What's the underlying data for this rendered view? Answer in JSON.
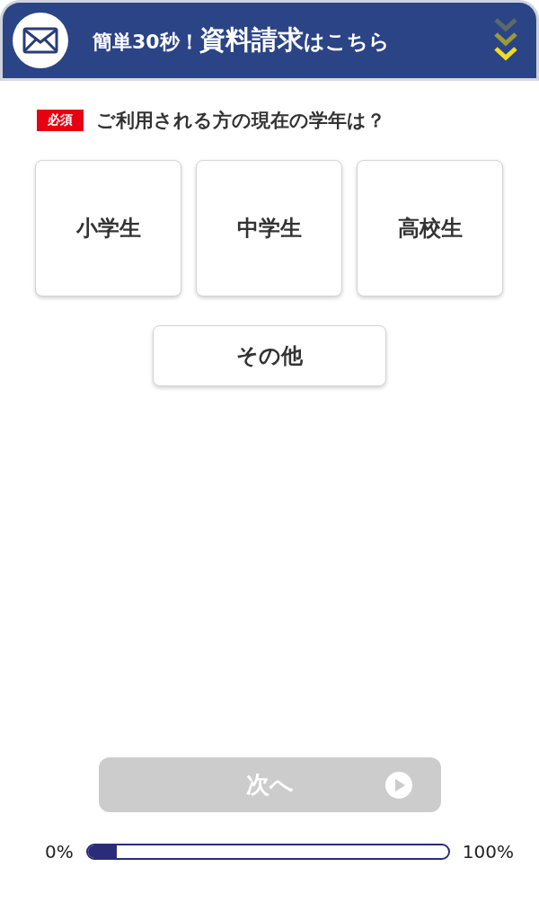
{
  "header": {
    "title_parts": [
      {
        "text": "簡単30秒！",
        "kind": "small"
      },
      {
        "text": "資料請求",
        "kind": "large"
      },
      {
        "text": "はこちら",
        "kind": "medium"
      }
    ]
  },
  "question": {
    "badge": "必須",
    "text": "ご利用される方の現在の学年は？"
  },
  "options": [
    {
      "label": "小学生",
      "selected": false,
      "kind": "card"
    },
    {
      "label": "中学生",
      "selected": false,
      "kind": "card"
    },
    {
      "label": "高校生",
      "selected": false,
      "kind": "card"
    },
    {
      "label": "その他",
      "selected": false,
      "kind": "wide"
    }
  ],
  "next_button": {
    "label": "次へ",
    "disabled": true
  },
  "progress": {
    "start": "0%",
    "end": "100%",
    "level": 0.08
  }
}
